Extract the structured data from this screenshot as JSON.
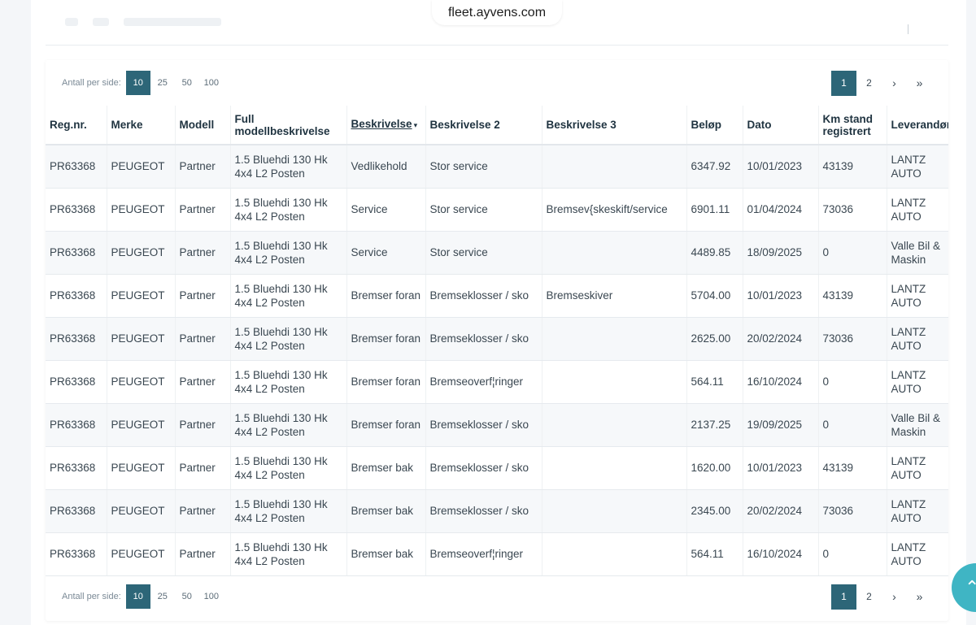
{
  "browser": {
    "url": "fleet.ayvens.com"
  },
  "pagination": {
    "per_page_label": "Antall per side:",
    "per_page_options": [
      "10",
      "25",
      "50",
      "100"
    ],
    "per_page_selected": "10",
    "pages": [
      "1",
      "2"
    ],
    "current_page": "1",
    "next_icon": "›",
    "last_icon": "»"
  },
  "table": {
    "sort_indicator": "▾",
    "headers": {
      "regnr": "Reg.nr.",
      "merke": "Merke",
      "modell": "Modell",
      "full_modell": "Full modellbeskrivelse",
      "beskrivelse": "Beskrivelse",
      "beskrivelse2": "Beskrivelse 2",
      "beskrivelse3": "Beskrivelse 3",
      "belop": "Beløp",
      "dato": "Dato",
      "km": "Km stand registrert",
      "leverandor": "Leverandør"
    },
    "rows": [
      {
        "regnr": "PR63368",
        "merke": "PEUGEOT",
        "modell": "Partner",
        "full_modell": "1.5 Bluehdi 130 Hk 4x4 L2 Posten",
        "beskrivelse": "Vedlikehold",
        "beskrivelse2": "Stor service",
        "beskrivelse3": "",
        "belop": "6347.92",
        "dato": "10/01/2023",
        "km": "43139",
        "leverandor": "LANTZ AUTO"
      },
      {
        "regnr": "PR63368",
        "merke": "PEUGEOT",
        "modell": "Partner",
        "full_modell": "1.5 Bluehdi 130 Hk 4x4 L2 Posten",
        "beskrivelse": "Service",
        "beskrivelse2": "Stor service",
        "beskrivelse3": "Bremsev{skeskift/service",
        "belop": "6901.11",
        "dato": "01/04/2024",
        "km": "73036",
        "leverandor": "LANTZ AUTO"
      },
      {
        "regnr": "PR63368",
        "merke": "PEUGEOT",
        "modell": "Partner",
        "full_modell": "1.5 Bluehdi 130 Hk 4x4 L2 Posten",
        "beskrivelse": "Service",
        "beskrivelse2": "Stor service",
        "beskrivelse3": "",
        "belop": "4489.85",
        "dato": "18/09/2025",
        "km": "0",
        "leverandor": "Valle Bil & Maskin"
      },
      {
        "regnr": "PR63368",
        "merke": "PEUGEOT",
        "modell": "Partner",
        "full_modell": "1.5 Bluehdi 130 Hk 4x4 L2 Posten",
        "beskrivelse": "Bremser foran",
        "beskrivelse2": "Bremseklosser / sko",
        "beskrivelse3": "Bremseskiver",
        "belop": "5704.00",
        "dato": "10/01/2023",
        "km": "43139",
        "leverandor": "LANTZ AUTO"
      },
      {
        "regnr": "PR63368",
        "merke": "PEUGEOT",
        "modell": "Partner",
        "full_modell": "1.5 Bluehdi 130 Hk 4x4 L2 Posten",
        "beskrivelse": "Bremser foran",
        "beskrivelse2": "Bremseklosser / sko",
        "beskrivelse3": "",
        "belop": "2625.00",
        "dato": "20/02/2024",
        "km": "73036",
        "leverandor": "LANTZ AUTO"
      },
      {
        "regnr": "PR63368",
        "merke": "PEUGEOT",
        "modell": "Partner",
        "full_modell": "1.5 Bluehdi 130 Hk 4x4 L2 Posten",
        "beskrivelse": "Bremser foran",
        "beskrivelse2": "Bremseoverf¦ringer",
        "beskrivelse3": "",
        "belop": "564.11",
        "dato": "16/10/2024",
        "km": "0",
        "leverandor": "LANTZ AUTO"
      },
      {
        "regnr": "PR63368",
        "merke": "PEUGEOT",
        "modell": "Partner",
        "full_modell": "1.5 Bluehdi 130 Hk 4x4 L2 Posten",
        "beskrivelse": "Bremser foran",
        "beskrivelse2": "Bremseklosser / sko",
        "beskrivelse3": "",
        "belop": "2137.25",
        "dato": "19/09/2025",
        "km": "0",
        "leverandor": "Valle Bil & Maskin"
      },
      {
        "regnr": "PR63368",
        "merke": "PEUGEOT",
        "modell": "Partner",
        "full_modell": "1.5 Bluehdi 130 Hk 4x4 L2 Posten",
        "beskrivelse": "Bremser bak",
        "beskrivelse2": "Bremseklosser / sko",
        "beskrivelse3": "",
        "belop": "1620.00",
        "dato": "10/01/2023",
        "km": "43139",
        "leverandor": "LANTZ AUTO"
      },
      {
        "regnr": "PR63368",
        "merke": "PEUGEOT",
        "modell": "Partner",
        "full_modell": "1.5 Bluehdi 130 Hk 4x4 L2 Posten",
        "beskrivelse": "Bremser bak",
        "beskrivelse2": "Bremseklosser / sko",
        "beskrivelse3": "",
        "belop": "2345.00",
        "dato": "20/02/2024",
        "km": "73036",
        "leverandor": "LANTZ AUTO"
      },
      {
        "regnr": "PR63368",
        "merke": "PEUGEOT",
        "modell": "Partner",
        "full_modell": "1.5 Bluehdi 130 Hk 4x4 L2 Posten",
        "beskrivelse": "Bremser bak",
        "beskrivelse2": "Bremseoverf¦ringer",
        "beskrivelse3": "",
        "belop": "564.11",
        "dato": "16/10/2024",
        "km": "0",
        "leverandor": "LANTZ AUTO"
      }
    ]
  },
  "fab": {
    "icon": "chevron-up-icon",
    "glyph": "⌃"
  }
}
